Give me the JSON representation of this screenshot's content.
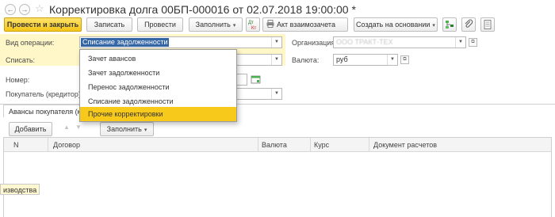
{
  "header": {
    "back_glyph": "←",
    "forward_glyph": "→",
    "star_glyph": "☆",
    "title": "Корректировка долга 00БП-000016 от 02.07.2018 19:00:00 *"
  },
  "toolbar": {
    "post_close_label": "Провести и закрыть",
    "save_label": "Записать",
    "post_label": "Провести",
    "fill_label": "Заполнить",
    "reconciliation_label": "Акт взаимозачета",
    "create_based_label": "Создать на основании",
    "caret": "▾",
    "accent_color": "#f5c518"
  },
  "form": {
    "operation_label": "Вид операции:",
    "operation_value": "Списание задолженности",
    "writeoff_label": "Списать:",
    "number_label": "Номер:",
    "buyer_label": "Покупатель (кредитор):",
    "organization_label": "Организация:",
    "organization_value": "ООО ТРАКТ-ТЕХ",
    "currency_label": "Валюта:",
    "currency_value": "руб"
  },
  "dropdown": {
    "items": [
      "Зачет авансов",
      "Зачет задолженности",
      "Перенос задолженности",
      "Списание задолженности",
      "Прочие корректировки"
    ],
    "selected_index": 4
  },
  "tabs": {
    "active_label": "Авансы покупателя (кр",
    "partial_label": "изводства"
  },
  "table_toolbar": {
    "add_label": "Добавить",
    "fill_label": "Заполнить",
    "up_glyph": "▲",
    "down_glyph": "▼"
  },
  "table": {
    "columns": [
      "N",
      "Договор",
      "Валюта",
      "Курс",
      "Документ расчетов"
    ]
  }
}
